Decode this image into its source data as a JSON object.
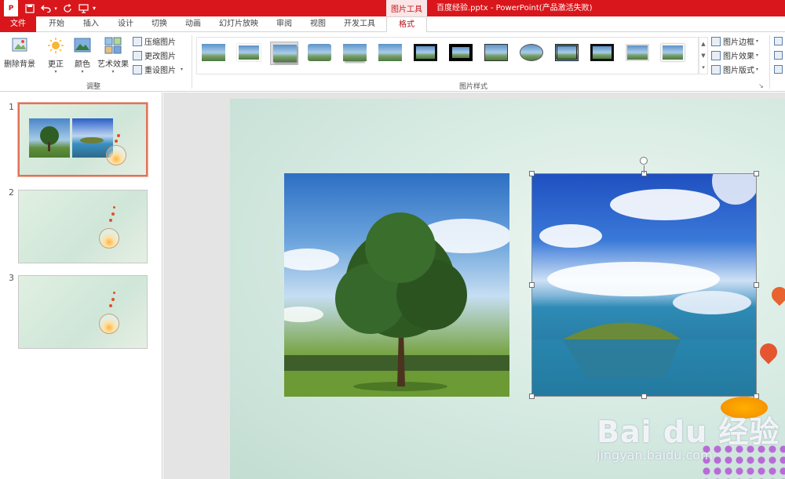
{
  "titlebar": {
    "contextual_label": "图片工具",
    "document_title": "百度经验.pptx - PowerPoint(产品激活失败)",
    "ppt_logo": "P"
  },
  "tabs": {
    "file": "文件",
    "items": [
      "开始",
      "插入",
      "设计",
      "切换",
      "动画",
      "幻灯片放映",
      "审阅",
      "视图",
      "开发工具",
      "格式"
    ],
    "active": "格式"
  },
  "ribbon": {
    "adjust": {
      "remove_bg": "删除背景",
      "corrections": "更正",
      "color": "颜色",
      "artistic": "艺术效果",
      "compress": "压缩图片",
      "change": "更改图片",
      "reset": "重设图片",
      "label": "调整"
    },
    "styles": {
      "label": "图片样式",
      "border": "图片边框",
      "effects": "图片效果",
      "layout": "图片版式"
    }
  },
  "slides": [
    {
      "number": "1",
      "selected": true
    },
    {
      "number": "2",
      "selected": false
    },
    {
      "number": "3",
      "selected": false
    }
  ],
  "watermark": {
    "main": "Bai du 经验",
    "sub": "jingyan.baidu.com"
  },
  "colors": {
    "brand": "#d9161b",
    "active_tab_text": "#b5101a",
    "selection_border": "#e0735a"
  }
}
